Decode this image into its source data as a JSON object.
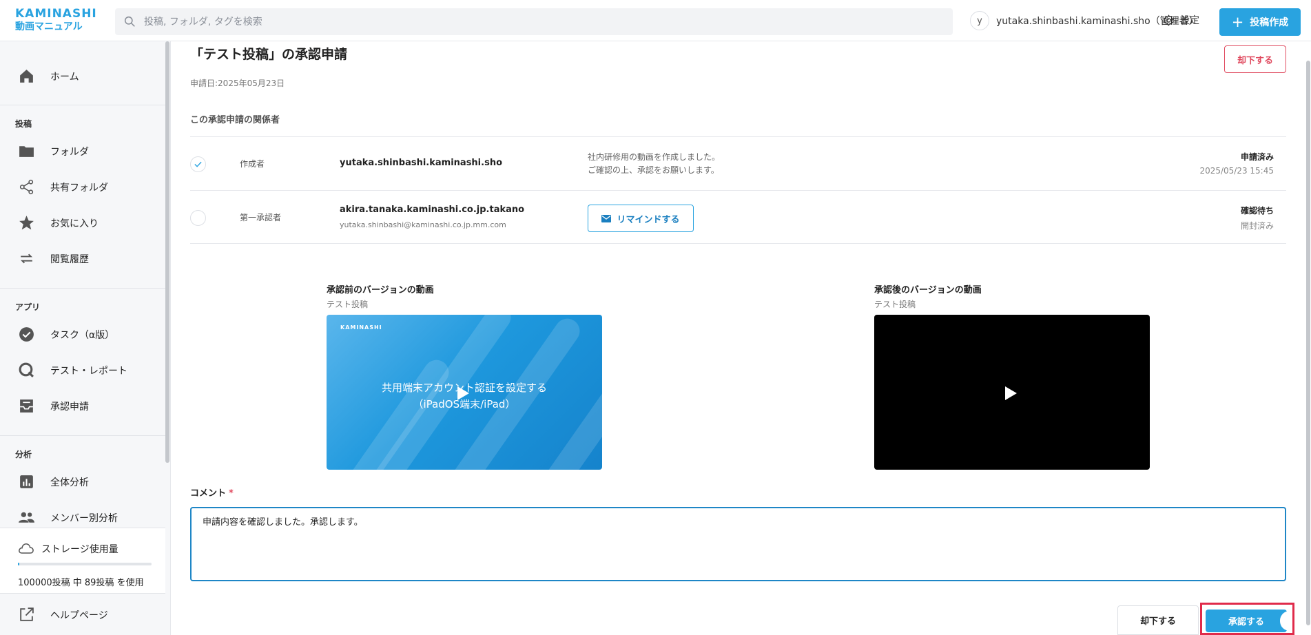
{
  "header": {
    "logo_main": "KAMINASHI",
    "logo_sub": "動画マニュアル",
    "search_placeholder": "投稿, フォルダ, タグを検索",
    "user_avatar_initial": "y",
    "user_name": "yutaka.shinbashi.kaminashi.sho（管理者）",
    "settings_label": "設定",
    "create_label": "投稿作成",
    "accent_color": "#29a3e0"
  },
  "sidebar": {
    "home": "ホーム",
    "section_posts": "投稿",
    "folder": "フォルダ",
    "shared_folder": "共有フォルダ",
    "favorites": "お気に入り",
    "history": "閲覧履歴",
    "section_apps": "アプリ",
    "task": "タスク（α版）",
    "test_report": "テスト・レポート",
    "approval": "承認申請",
    "section_analysis": "分析",
    "overall": "全体分析",
    "member": "メンバー別分析",
    "storage_title": "ストレージ使用量",
    "storage_text": "100000投稿 中 89投稿 を使用",
    "storage_used_fraction": 0.0009,
    "help": "ヘルプページ"
  },
  "main": {
    "title": "「テスト投稿」の承認申請",
    "date": "申請日:2025年05月23日",
    "reject_top": "却下する",
    "related_title": "この承認申請の関係者",
    "rows": [
      {
        "role": "作成者",
        "name": "yutaka.shinbashi.kaminashi.sho",
        "message_line1": "社内研修用の動画を作成しました。",
        "message_line2": "ご確認の上、承認をお願いします。",
        "status": "申請済み",
        "status_sub": "2025/05/23 15:45"
      },
      {
        "role": "第一承認者",
        "name": "akira.tanaka.kaminashi.co.jp.takano",
        "email": "yutaka.shinbashi@kaminashi.co.jp.mm.com",
        "remind": "リマインドする",
        "status": "確認待ち",
        "status_sub": "開封済み"
      }
    ],
    "before_title": "承認前のバージョンの動画",
    "before_sub": "テスト投稿",
    "before_brand": "KAMINASHI",
    "before_text1": "共用端末アカウント認証を設定する",
    "before_text2": "（iPadOS端末/iPad）",
    "after_title": "承認後のバージョンの動画",
    "after_sub": "テスト投稿",
    "comment_label": "コメント",
    "comment_required": "*",
    "comment_value": "申請内容を確認しました。承認します。",
    "reject_bottom": "却下する",
    "approve": "承認する",
    "reject_color": "#e04a5f"
  }
}
